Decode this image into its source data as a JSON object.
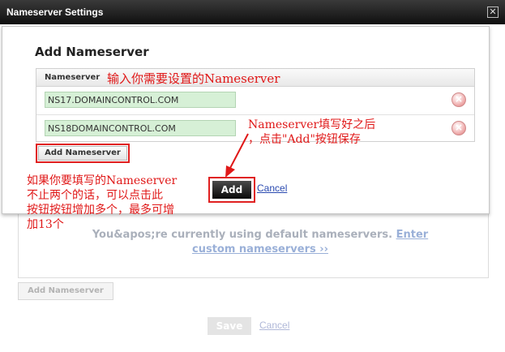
{
  "window": {
    "title": "Nameserver Settings"
  },
  "background": {
    "message": "You&apos;re currently using default nameservers.",
    "link": "Enter custom nameservers ››",
    "add_button": "Add Nameserver",
    "save_button": "Save",
    "cancel_link": "Cancel"
  },
  "dialog": {
    "title": "Add Nameserver",
    "column_header": "Nameserver",
    "rows": [
      {
        "value": "NS17.DOMAINCONTROL.COM"
      },
      {
        "value": "NS18DOMAINCONTROL.COM"
      }
    ],
    "add_nameserver_button": "Add Nameserver",
    "add_button": "Add",
    "cancel_link": "Cancel"
  },
  "annotations": {
    "header_note": "输入你需要设置的Nameserver",
    "add_note_line1": "Nameserver填写好之后",
    "add_note_line2": "，点击\"Add\"按钮保存",
    "more_note_line1": "如果你要填写的Nameserver",
    "more_note_line2": "不止两个的话，可以点击此",
    "more_note_line3": "按钮按钮增加多个，最多可增",
    "more_note_line4": "加13个"
  },
  "colors": {
    "annotation": "#e01818",
    "input_bg": "#d6f0d6",
    "link": "#2a4ab0"
  }
}
